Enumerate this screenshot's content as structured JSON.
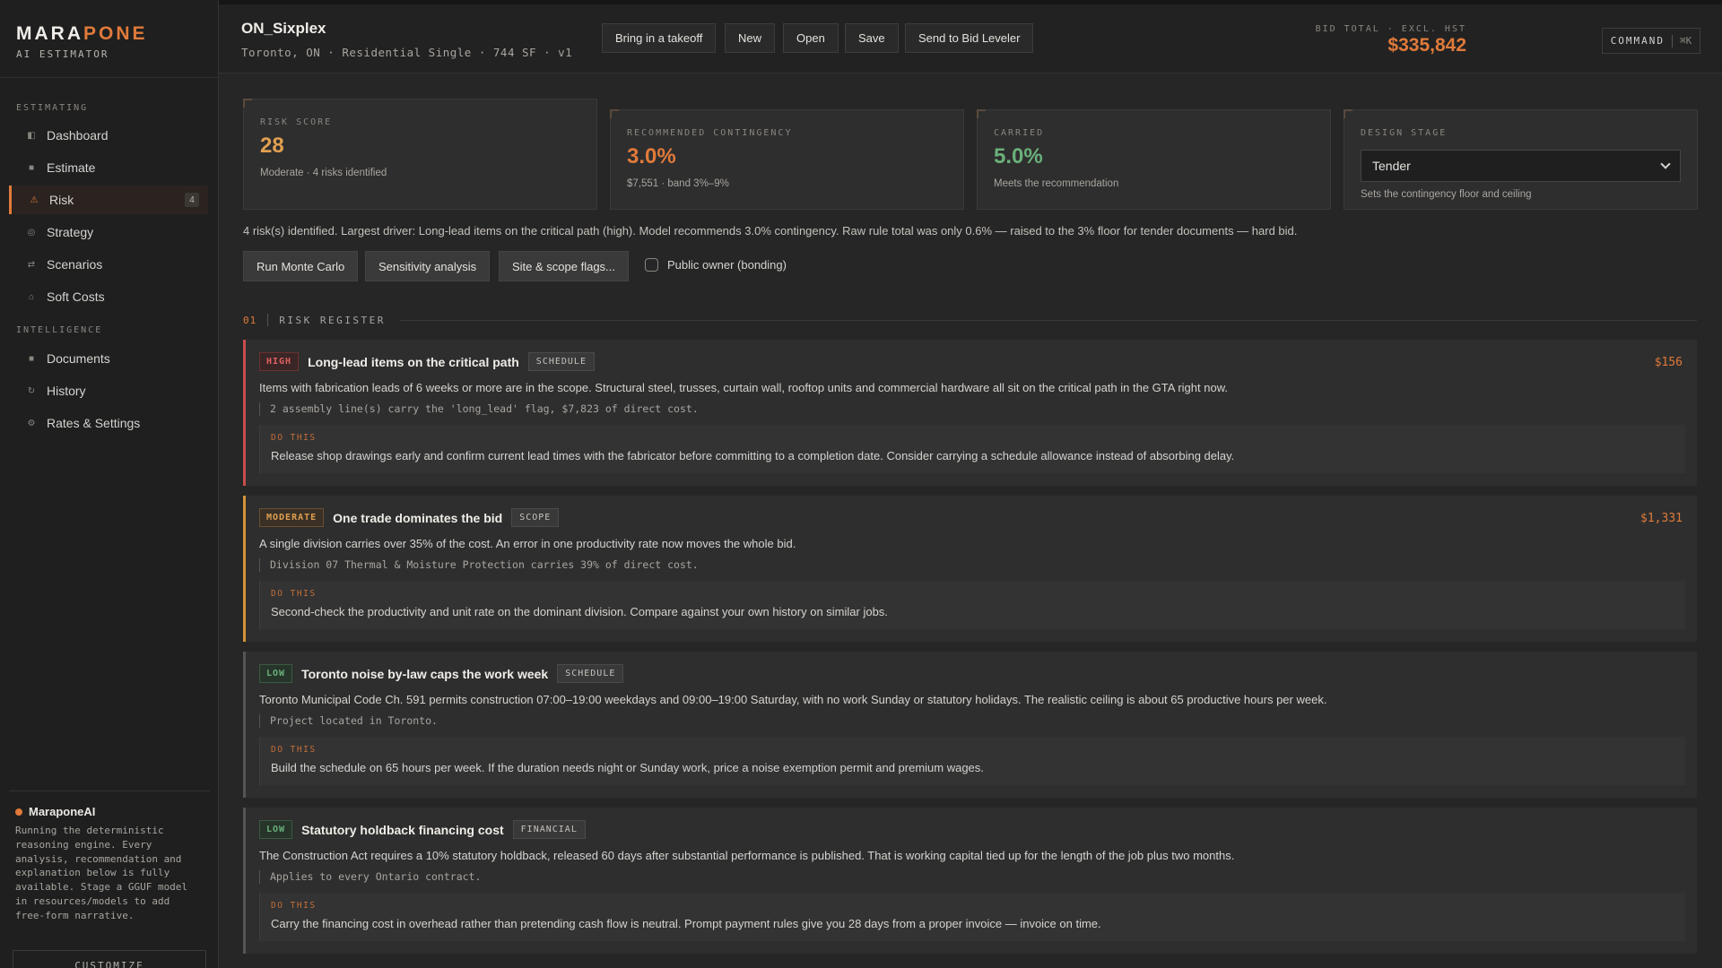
{
  "brand": {
    "name_main": "MARA",
    "name_accent": "PONE",
    "subtitle": "AI ESTIMATOR"
  },
  "sidebar": {
    "sections": [
      {
        "label": "ESTIMATING",
        "items": [
          {
            "label": "Dashboard",
            "icon": "dashboard-icon"
          },
          {
            "label": "Estimate",
            "icon": "estimate-icon"
          },
          {
            "label": "Risk",
            "icon": "warning-icon",
            "active": true,
            "badge": "4"
          },
          {
            "label": "Strategy",
            "icon": "strategy-icon"
          },
          {
            "label": "Scenarios",
            "icon": "scenarios-icon"
          },
          {
            "label": "Soft Costs",
            "icon": "home-icon"
          }
        ]
      },
      {
        "label": "INTELLIGENCE",
        "items": [
          {
            "label": "Documents",
            "icon": "documents-icon"
          },
          {
            "label": "History",
            "icon": "history-icon"
          },
          {
            "label": "Rates & Settings",
            "icon": "settings-icon"
          }
        ]
      }
    ],
    "ai": {
      "title": "MaraponeAI",
      "description": "Running the deterministic\nreasoning engine. Every\nanalysis, recommendation and\nexplanation below is fully\navailable. Stage a GGUF model\nin resources/models to add\nfree-form narrative."
    },
    "customize_label": "CUSTOMIZE"
  },
  "header": {
    "project_title": "ON_Sixplex",
    "project_subtitle": "Toronto, ON · Residential Single · 744 SF · v1",
    "buttons": [
      "Bring in a takeoff",
      "New",
      "Open",
      "Save",
      "Send to Bid Leveler"
    ],
    "bid_label": "BID TOTAL · EXCL. HST",
    "bid_value": "$335,842",
    "command_label": "COMMAND",
    "command_kbd": "⌘K"
  },
  "cards": {
    "risk_score": {
      "label": "RISK SCORE",
      "value": "28",
      "sub": "Moderate · 4 risks identified"
    },
    "contingency": {
      "label": "RECOMMENDED CONTINGENCY",
      "value": "3.0%",
      "sub": "$7,551 · band 3%–9%"
    },
    "carried": {
      "label": "CARRIED",
      "value": "5.0%",
      "sub": "Meets the recommendation"
    },
    "design_stage": {
      "label": "DESIGN STAGE",
      "selected": "Tender",
      "sub": "Sets the contingency floor and ceiling"
    }
  },
  "summary": "4 risk(s) identified. Largest driver: Long-lead items on the critical path (high). Model recommends 3.0% contingency. Raw rule total was only 0.6% — raised to the 3% floor for tender documents — hard bid.",
  "actions": {
    "monte_carlo": "Run Monte Carlo",
    "sensitivity": "Sensitivity analysis",
    "flags": "Site & scope flags...",
    "public_owner": "Public owner (bonding)"
  },
  "register": {
    "number": "01",
    "title": "RISK REGISTER",
    "do_label": "DO THIS"
  },
  "risks": [
    {
      "level": "HIGH",
      "title": "Long-lead items on the critical path",
      "category": "SCHEDULE",
      "amount": "$156",
      "description": "Items with fabrication leads of 6 weeks or more are in the scope. Structural steel, trusses, curtain wall, rooftop units and commercial hardware all sit on the critical path in the GTA right now.",
      "evidence": "2 assembly line(s) carry the 'long_lead' flag, $7,823 of direct cost.",
      "action": "Release shop drawings early and confirm current lead times with the fabricator before committing to a completion date. Consider carrying a schedule allowance instead of absorbing delay."
    },
    {
      "level": "MODERATE",
      "title": "One trade dominates the bid",
      "category": "SCOPE",
      "amount": "$1,331",
      "description": "A single division carries over 35% of the cost. An error in one productivity rate now moves the whole bid.",
      "evidence": "Division 07 Thermal & Moisture Protection carries 39% of direct cost.",
      "action": "Second-check the productivity and unit rate on the dominant division. Compare against your own history on similar jobs."
    },
    {
      "level": "LOW",
      "title": "Toronto noise by-law caps the work week",
      "category": "SCHEDULE",
      "amount": "",
      "description": "Toronto Municipal Code Ch. 591 permits construction 07:00–19:00 weekdays and 09:00–19:00 Saturday, with no work Sunday or statutory holidays. The realistic ceiling is about 65 productive hours per week.",
      "evidence": "Project located in Toronto.",
      "action": "Build the schedule on 65 hours per week. If the duration needs night or Sunday work, price a noise exemption permit and premium wages."
    },
    {
      "level": "LOW",
      "title": "Statutory holdback financing cost",
      "category": "FINANCIAL",
      "amount": "",
      "description": "The Construction Act requires a 10% statutory holdback, released 60 days after substantial performance is published. That is working capital tied up for the length of the job plus two months.",
      "evidence": "Applies to every Ontario contract.",
      "action": "Carry the financing cost in overhead rather than pretending cash flow is neutral. Prompt payment rules give you 28 days from a proper invoice — invoice on time."
    }
  ],
  "colors": {
    "accent": "#e07a3a",
    "good": "#6ab07a",
    "high": "#c94c4c",
    "moderate": "#d4943a"
  }
}
